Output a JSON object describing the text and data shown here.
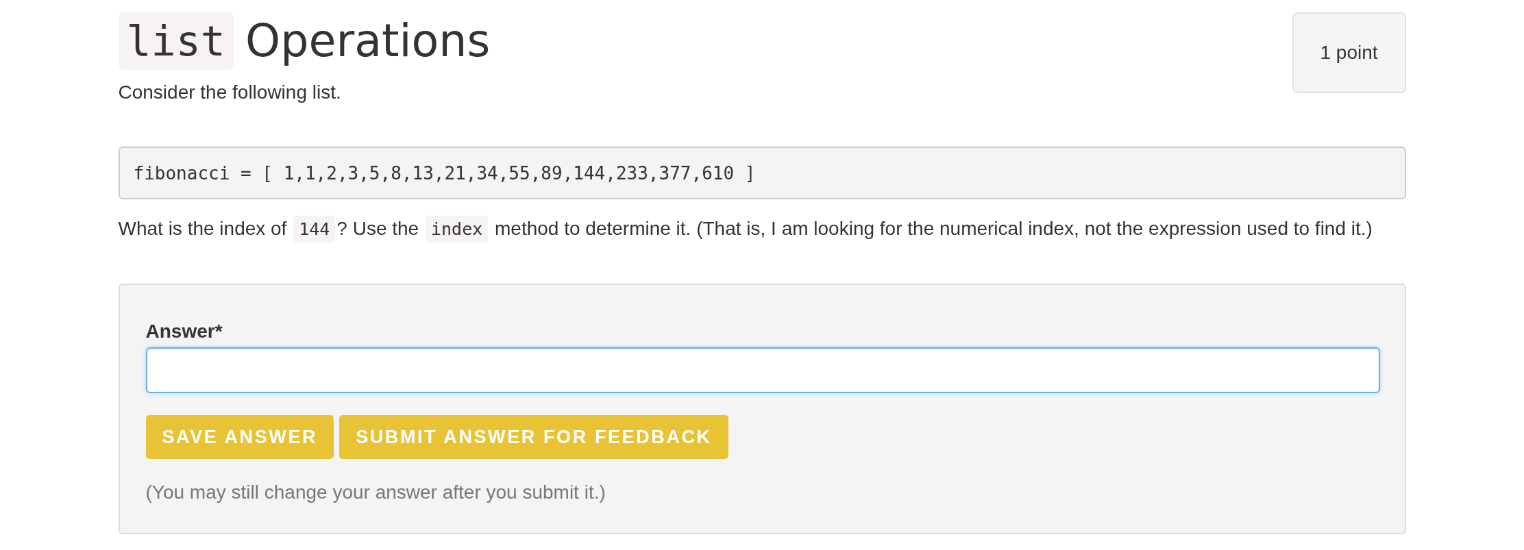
{
  "header": {
    "title": [
      {
        "kind": "code",
        "text": "list"
      },
      {
        "kind": "text",
        "text": "Operations"
      }
    ],
    "points": "1 point"
  },
  "intro": "Consider the following list.",
  "code_block": "fibonacci = [ 1,1,2,3,5,8,13,21,34,55,89,144,233,377,610 ]",
  "question": [
    {
      "kind": "text",
      "text": "What is the index of "
    },
    {
      "kind": "code",
      "text": "144"
    },
    {
      "kind": "text",
      "text": "? Use the "
    },
    {
      "kind": "code",
      "text": "index"
    },
    {
      "kind": "text",
      "text": " method to determine it. (That is, I am looking for the numerical index, not the expression used to find it.)"
    }
  ],
  "answer": {
    "label": "Answer*",
    "focused": true,
    "buttons": [
      {
        "label": "SAVE ANSWER"
      },
      {
        "label": "SUBMIT ANSWER FOR FEEDBACK"
      }
    ],
    "note": "(You may still change your answer after you submit it.)"
  }
}
